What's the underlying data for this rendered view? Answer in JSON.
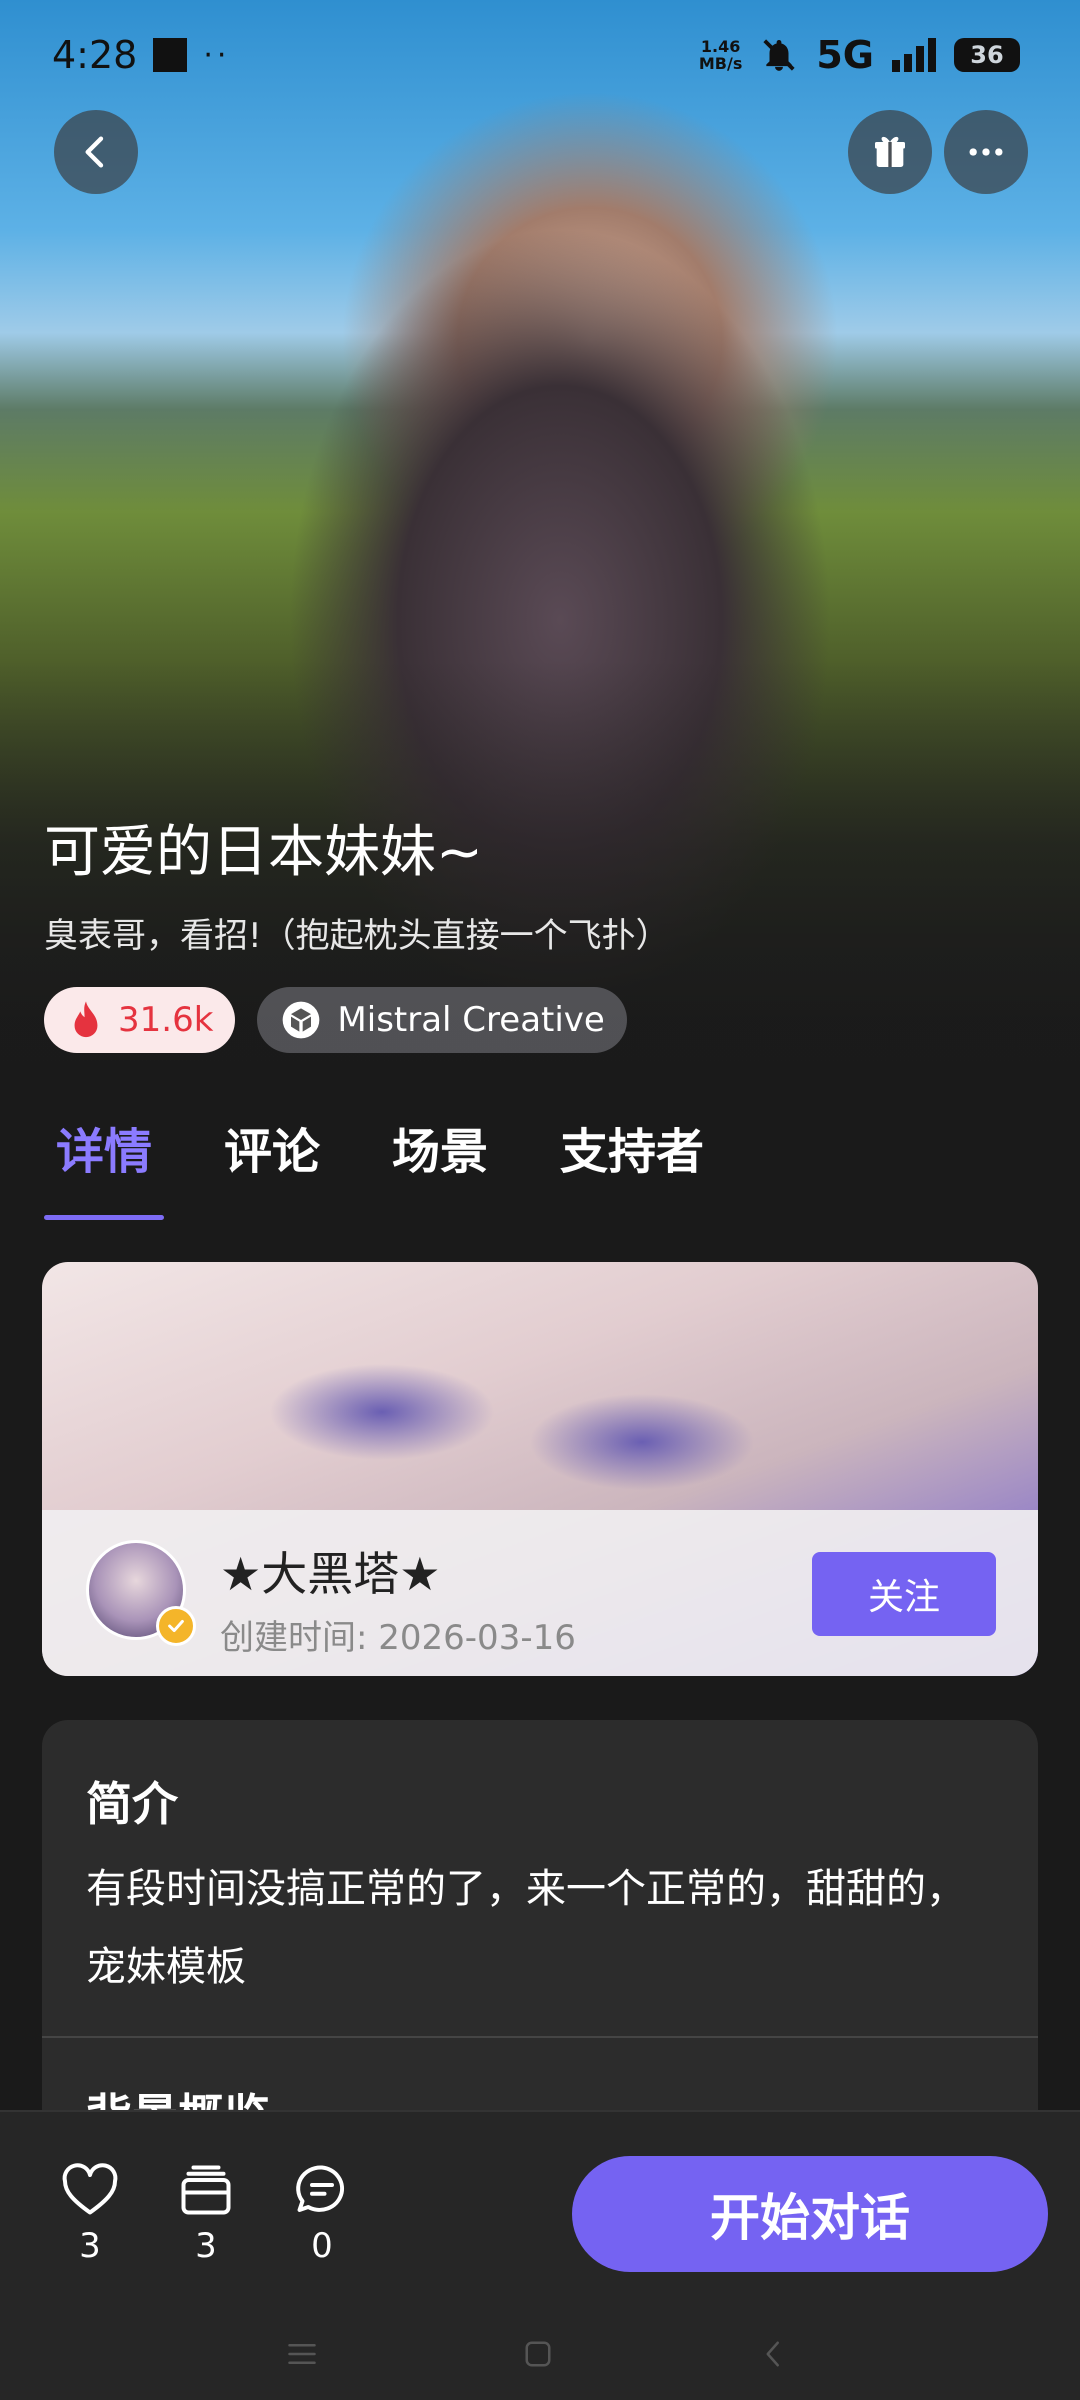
{
  "status_bar": {
    "time": "4:28",
    "net_speed_value": "1.46",
    "net_speed_unit": "MB/s",
    "network": "5G",
    "battery": "36"
  },
  "header": {
    "back_icon": "chevron-left-icon",
    "gift_icon": "gift-icon",
    "more_icon": "more-horizontal-icon"
  },
  "character": {
    "title": "可爱的日本妹妹~",
    "subtitle": "臭表哥，看招!（抱起枕头直接一个飞扑）",
    "hot_count": "31.6k",
    "model_name": "Mistral Creative"
  },
  "tabs": [
    {
      "label": "详情",
      "active": true
    },
    {
      "label": "评论",
      "active": false
    },
    {
      "label": "场景",
      "active": false
    },
    {
      "label": "支持者",
      "active": false
    }
  ],
  "creator": {
    "name": "★大黑塔★",
    "created_at": "创建时间: 2026-03-16",
    "follow_label": "关注"
  },
  "intro": {
    "title": "简介",
    "text": "有段时间没搞正常的了，来一个正常的，甜甜的，宠妹模板",
    "next_section_title": "背景概览"
  },
  "bottom_actions": {
    "likes": "3",
    "cards": "3",
    "comments": "0",
    "start_label": "开始对话"
  },
  "colors": {
    "accent": "#7563f2",
    "tab_active": "#8b7bff",
    "hot": "#e5333f",
    "background": "#1a1a1a"
  }
}
